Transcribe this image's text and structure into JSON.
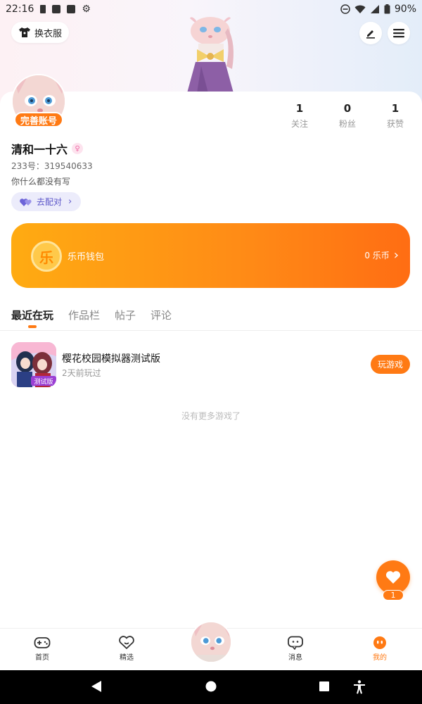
{
  "status_bar": {
    "time": "22:16",
    "battery": "90%"
  },
  "header": {
    "dress_label": "换衣服",
    "edit_icon": "pencil-icon",
    "menu_icon": "hamburger-icon"
  },
  "profile": {
    "complete_label": "完善账号",
    "name": "清和一十六",
    "gender": "♀",
    "uid": "233号：319540633",
    "bio": "你什么都没有写",
    "match_label": "去配对",
    "stats": [
      {
        "value": "1",
        "label": "关注"
      },
      {
        "value": "0",
        "label": "粉丝"
      },
      {
        "value": "1",
        "label": "获赞"
      }
    ]
  },
  "wallet": {
    "coin_char": "乐",
    "label": "乐币钱包",
    "value": "0 乐币"
  },
  "tabs": [
    {
      "label": "最近在玩",
      "active": true
    },
    {
      "label": "作品栏",
      "active": false
    },
    {
      "label": "帖子",
      "active": false
    },
    {
      "label": "评论",
      "active": false
    }
  ],
  "games": [
    {
      "name": "樱花校园模拟器测试版",
      "time": "2天前玩过",
      "play_label": "玩游戏",
      "icon_badge": "测试版"
    }
  ],
  "no_more": "没有更多游戏了",
  "fab": {
    "count": "1"
  },
  "bottom_nav": [
    {
      "label": "首页",
      "icon": "gamepad-icon"
    },
    {
      "label": "精选",
      "icon": "heart-outline-icon"
    },
    {
      "label": "消息",
      "icon": "chat-bubble-icon"
    },
    {
      "label": "我的",
      "icon": "smile-face-icon",
      "active": true
    }
  ],
  "colors": {
    "accent": "#ff7a14",
    "match_bg": "#ececfb",
    "match_text": "#5b55c9"
  }
}
